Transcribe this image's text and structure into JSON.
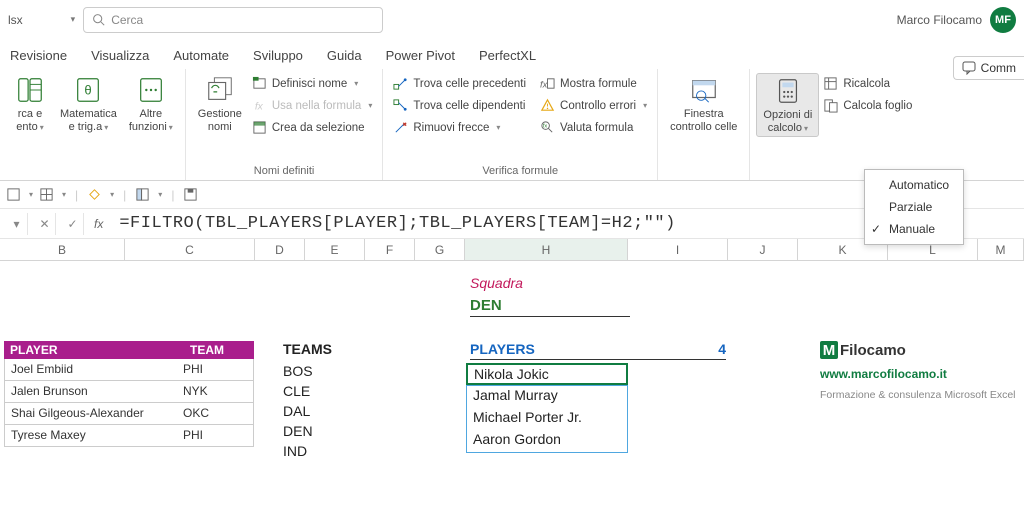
{
  "title_ext": "lsx",
  "search_placeholder": "Cerca",
  "user": {
    "name": "Marco Filocamo",
    "initials": "MF"
  },
  "tabs": [
    "Revisione",
    "Visualizza",
    "Automate",
    "Sviluppo",
    "Guida",
    "Power Pivot",
    "PerfectXL"
  ],
  "ribbon": {
    "lookup": {
      "label": "rca e\nento",
      "drop": true
    },
    "math": {
      "label": "Matematica\ne trig.a",
      "drop": true
    },
    "more": {
      "label": "Altre\nfunzioni",
      "drop": true
    },
    "name_mgr": {
      "label": "Gestione\nnomi"
    },
    "names_group": "Nomi definiti",
    "def_name": "Definisci nome",
    "use_in": "Usa nella formula",
    "create_sel": "Crea da selezione",
    "trace_prec": "Trova celle precedenti",
    "trace_dep": "Trova celle dipendenti",
    "remove_arrows": "Rimuovi frecce",
    "show_formulas": "Mostra formule",
    "err_check": "Controllo errori",
    "eval": "Valuta formula",
    "audit_group": "Verifica formule",
    "watch": {
      "label": "Finestra\ncontrollo celle"
    },
    "calc_opts": {
      "label": "Opzioni di\ncalcolo"
    },
    "recalc": "Ricalcola",
    "calc_sheet": "Calcola foglio"
  },
  "calc_menu": [
    "Automatico",
    "Parziale",
    "Manuale"
  ],
  "formula": "=FILTRO(TBL_PLAYERS[PLAYER];TBL_PLAYERS[TEAM]=H2;\"\")",
  "cols": [
    "B",
    "C",
    "D",
    "E",
    "F",
    "G",
    "H",
    "I",
    "J",
    "K",
    "L",
    "M"
  ],
  "squadra_label": "Squadra",
  "selected_team": "DEN",
  "players_tbl": {
    "h1": "PLAYER",
    "h2": "TEAM",
    "rows": [
      [
        "Joel Embiid",
        "PHI"
      ],
      [
        "Jalen Brunson",
        "NYK"
      ],
      [
        "Shai Gilgeous-Alexander",
        "OKC"
      ],
      [
        "Tyrese Maxey",
        "PHI"
      ]
    ]
  },
  "teams": {
    "hdr": "TEAMS",
    "list": [
      "BOS",
      "CLE",
      "DAL",
      "DEN",
      "IND"
    ]
  },
  "filtered": {
    "hdr": "PLAYERS",
    "count": "4",
    "list": [
      "Nikola Jokic",
      "Jamal Murray",
      "Michael Porter Jr.",
      "Aaron Gordon"
    ]
  },
  "brand": {
    "name": "Filocamo",
    "url": "www.marcofilocamo.it",
    "tag": "Formazione & consulenza Microsoft Excel"
  },
  "comments": "Comm"
}
